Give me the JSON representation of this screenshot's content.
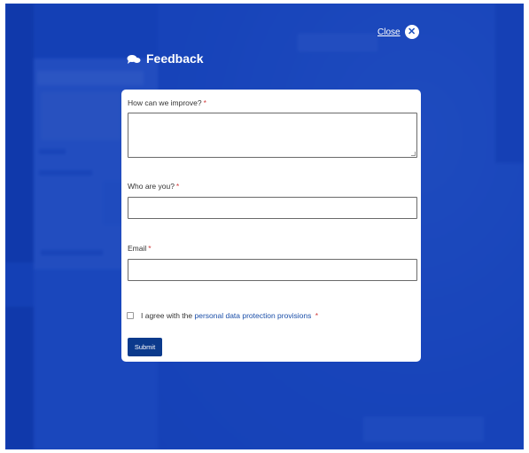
{
  "modal": {
    "title": "Feedback",
    "close_label": "Close",
    "close_icon": "close-icon",
    "title_icon": "chat-bubbles-icon"
  },
  "form": {
    "improve_label": "How can we improve?",
    "who_label": "Who are you?",
    "email_label": "Email",
    "required_mark": "*",
    "agree_prefix": "I agree with the",
    "agree_link": "personal data protection provisions",
    "submit_label": "Submit"
  },
  "colors": {
    "overlay": "#0c37b4",
    "submit": "#0b3a8c",
    "link": "#1a4ea8",
    "required": "#d13b3b"
  }
}
